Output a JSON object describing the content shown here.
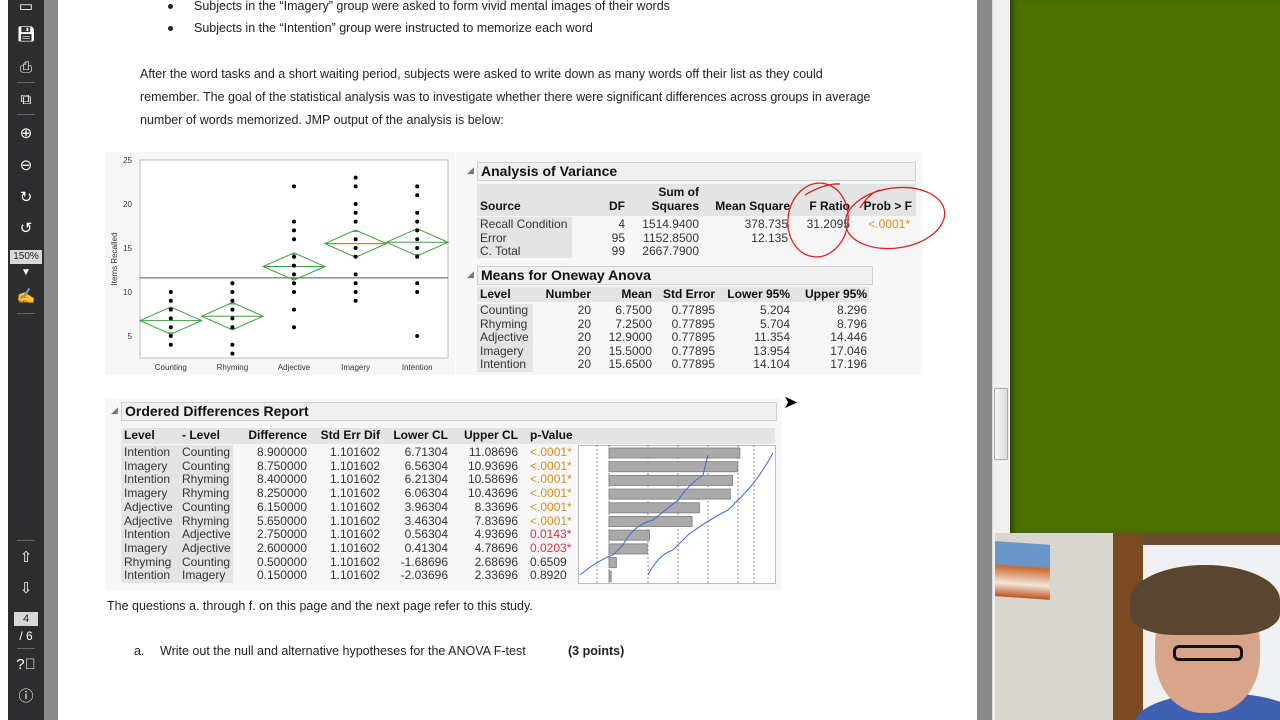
{
  "viewer": {
    "toolbar_icons": [
      "open-icon",
      "save-icon",
      "print-icon",
      "select-icon",
      "zoom-in-icon",
      "zoom-out-icon",
      "rotate-cw-icon",
      "rotate-ccw-icon",
      "sign-icon",
      "page-up-icon",
      "page-down-icon",
      "help-icon",
      "info-icon"
    ],
    "zoom_level": "150%",
    "current_page": "4",
    "total_pages": "/ 6"
  },
  "document": {
    "bullets": [
      "Subjects in the “Imagery” group were asked to form vivid mental images of their words",
      "Subjects in the “Intention” group were instructed to memorize each word"
    ],
    "paragraph_lines": [
      "After the word tasks and a short waiting period, subjects were asked to write down as many words off their list as they could",
      "remember.  The goal of the statistical analysis was to investigate whether there were significant differences across groups in average",
      "number of words memorized.  JMP output of the analysis is below:"
    ],
    "questions_intro": "The questions a. through f. on this page and the next page refer to this study.",
    "question_a": {
      "label": "a.",
      "text": "Write out the null and alternative hypotheses for the ANOVA F-test",
      "points": "(3 points)"
    }
  },
  "chart_data": {
    "type": "scatter",
    "ylabel": "Items Recalled",
    "xlabel": "",
    "categories": [
      "Counting",
      "Rhyming",
      "Adjective",
      "Imagery",
      "Intention"
    ],
    "yticks": [
      5,
      10,
      15,
      20,
      25
    ],
    "ylim": [
      2.5,
      25
    ],
    "grand_mean": 11.6,
    "points": {
      "Counting": [
        4,
        5,
        6,
        7,
        8,
        9,
        10
      ],
      "Rhyming": [
        3,
        4,
        6,
        7,
        8,
        9,
        10,
        11
      ],
      "Adjective": [
        6,
        8,
        10,
        11,
        12,
        13,
        14,
        16,
        17,
        18,
        22
      ],
      "Imagery": [
        9,
        10,
        11,
        12,
        14,
        15,
        16,
        18,
        19,
        20,
        22,
        23
      ],
      "Intention": [
        5,
        10,
        11,
        14,
        15,
        16,
        17,
        18,
        19,
        21,
        22
      ]
    },
    "means_diamonds": [
      {
        "mean": 6.75,
        "lower": 5.204,
        "upper": 8.296
      },
      {
        "mean": 7.25,
        "lower": 5.704,
        "upper": 8.796
      },
      {
        "mean": 12.9,
        "lower": 11.354,
        "upper": 14.446
      },
      {
        "mean": 15.5,
        "lower": 13.954,
        "upper": 17.046
      },
      {
        "mean": 15.65,
        "lower": 14.104,
        "upper": 17.196
      }
    ],
    "diamond_color": "#3aa03a"
  },
  "anova": {
    "title": "Analysis of Variance",
    "headers": [
      "Source",
      "DF",
      "Sum of",
      "Squares",
      "Mean Square",
      "F Ratio",
      "Prob > F"
    ],
    "rows": [
      [
        "Recall Condition",
        "4",
        "1514.9400",
        "378.735",
        "31.2095",
        "<.0001*"
      ],
      [
        "Error",
        "95",
        "1152.8500",
        "12.135",
        "",
        ""
      ],
      [
        "C. Total",
        "99",
        "2667.7900",
        "",
        "",
        ""
      ]
    ]
  },
  "means": {
    "title": "Means for Oneway Anova",
    "headers": [
      "Level",
      "Number",
      "Mean",
      "Std Error",
      "Lower 95%",
      "Upper 95%"
    ],
    "rows": [
      [
        "Counting",
        "20",
        "6.7500",
        "0.77895",
        "5.204",
        "8.296"
      ],
      [
        "Rhyming",
        "20",
        "7.2500",
        "0.77895",
        "5.704",
        "8.796"
      ],
      [
        "Adjective",
        "20",
        "12.9000",
        "0.77895",
        "11.354",
        "14.446"
      ],
      [
        "Imagery",
        "20",
        "15.5000",
        "0.77895",
        "13.954",
        "17.046"
      ],
      [
        "Intention",
        "20",
        "15.6500",
        "0.77895",
        "14.104",
        "17.196"
      ]
    ]
  },
  "ordered": {
    "title": "Ordered Differences Report",
    "headers": [
      "Level",
      "- Level",
      "Difference",
      "Std Err Dif",
      "Lower CL",
      "Upper CL",
      "p-Value"
    ],
    "rows": [
      [
        "Intention",
        "Counting",
        "8.900000",
        "1.101602",
        "6.71304",
        "11.08696",
        "<.0001*"
      ],
      [
        "Imagery",
        "Counting",
        "8.750000",
        "1.101602",
        "6.56304",
        "10.93696",
        "<.0001*"
      ],
      [
        "Intention",
        "Rhyming",
        "8.400000",
        "1.101602",
        "6.21304",
        "10.58696",
        "<.0001*"
      ],
      [
        "Imagery",
        "Rhyming",
        "8.250000",
        "1.101602",
        "6.06304",
        "10.43696",
        "<.0001*"
      ],
      [
        "Adjective",
        "Counting",
        "6.150000",
        "1.101602",
        "3.96304",
        "8.33696",
        "<.0001*"
      ],
      [
        "Adjective",
        "Rhyming",
        "5.650000",
        "1.101602",
        "3.46304",
        "7.83696",
        "<.0001*"
      ],
      [
        "Intention",
        "Adjective",
        "2.750000",
        "1.101602",
        "0.56304",
        "4.93696",
        "0.0143*"
      ],
      [
        "Imagery",
        "Adjective",
        "2.600000",
        "1.101602",
        "0.41304",
        "4.78696",
        "0.0203*"
      ],
      [
        "Rhyming",
        "Counting",
        "0.500000",
        "1.101602",
        "-1.68696",
        "2.68696",
        "0.6509"
      ],
      [
        "Intention",
        "Imagery",
        "0.150000",
        "1.101602",
        "-2.03696",
        "2.33696",
        "0.8920"
      ]
    ],
    "pvalue_colors": {
      "highly_significant": "#e08a1e",
      "significant": "#e0304a"
    }
  },
  "annotation_color": "#e02020"
}
